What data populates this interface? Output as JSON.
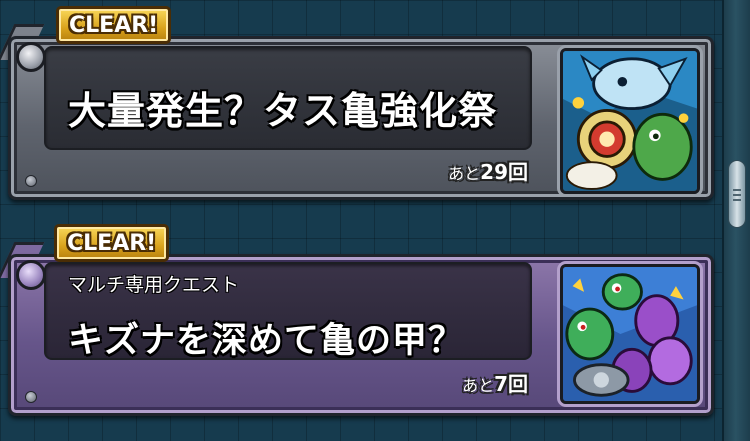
{
  "quests": [
    {
      "badge": "CLEAR!",
      "subtitle": "",
      "title": "大量発生？タス亀強化祭",
      "remaining_prefix": "あと",
      "remaining_value": "29回",
      "thumbnail_icon": "blue-dragon-and-turtles-icon"
    },
    {
      "badge": "CLEAR!",
      "subtitle": "マルチ専用クエスト",
      "title": "キズナを深めて亀の甲？",
      "remaining_prefix": "あと",
      "remaining_value": "7回",
      "thumbnail_icon": "green-turtles-with-eggs-icon"
    }
  ],
  "colors": {
    "background": "#163b4e",
    "card_gray": "#6a6f78",
    "card_purple": "#66558a",
    "badge_gold": "#e2b22a"
  }
}
